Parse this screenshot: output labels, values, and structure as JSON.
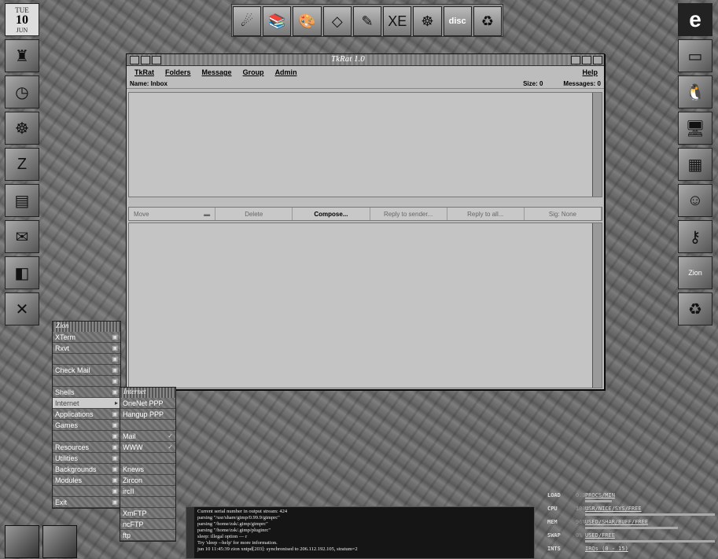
{
  "calendar": {
    "day": "TUE",
    "date": "10",
    "month": "JUN"
  },
  "top_launcher": {
    "items": [
      {
        "name": "comet-icon",
        "glyph": "☄"
      },
      {
        "name": "books-icon",
        "glyph": "📚"
      },
      {
        "name": "paint-palette-icon",
        "glyph": "🎨"
      },
      {
        "name": "draw-icon",
        "glyph": "◇"
      },
      {
        "name": "tools-icon",
        "glyph": "✎"
      },
      {
        "name": "xe-icon",
        "glyph": "XE"
      },
      {
        "name": "helm-icon",
        "glyph": "☸"
      },
      {
        "name": "disc-icon",
        "glyph": "disc"
      },
      {
        "name": "recycle-icon",
        "glyph": "♻"
      }
    ]
  },
  "left_dock": [
    "wizard-icon",
    "clock-icon",
    "helm-icon",
    "zion-z-icon",
    "document-icon",
    "mail-icon",
    "cube-icon",
    "x-icon"
  ],
  "right_dock": {
    "e_label": "e",
    "zion_label": "Zion"
  },
  "tkrat": {
    "title": "TkRat 1.0",
    "menu": {
      "tkrat": "TkRat",
      "folders": "Folders",
      "message": "Message",
      "group": "Group",
      "admin": "Admin",
      "help": "Help"
    },
    "info": {
      "name": "Name: Inbox",
      "size": "Size: 0",
      "messages": "Messages: 0"
    },
    "buttons": {
      "move": "Move",
      "delete": "Delete",
      "compose": "Compose...",
      "reply_sender": "Reply to sender...",
      "reply_all": "Reply to all...",
      "sig": "Sig: None"
    }
  },
  "root_menu": {
    "title": "Zion",
    "items": [
      "XTerm",
      "Rxvt",
      "",
      "Check Mail",
      "",
      "Shells",
      "Internet",
      "Applications",
      "Games",
      "",
      "Resources",
      "Utilities",
      "Backgrounds",
      "Modules",
      "",
      "Exit"
    ]
  },
  "internet_menu": {
    "title": "Internet",
    "items": [
      "OneNet PPP",
      "Hangup PPP",
      "",
      "Mail",
      "WWW",
      "",
      "Knews",
      "Zircon",
      "ircII",
      "",
      "XmFTP",
      "ncFTP",
      "ftp"
    ]
  },
  "terminal": {
    "lines": [
      "Current serial number in output stream: 424",
      "parsing \"/usr/share/gimp/0.99.9/gimprc\"",
      "parsing \"/home/zsk/.gimp/gimprc\"",
      "parsing \"/home/zsk/.gimp/pluginrc\"",
      "sleep: illegal option — r",
      "Try 'sleep --help' for more information.",
      "jun 10 11:45:39 zion xntpd[203]: synchronised to 206.112.192.105, stratum=2"
    ]
  },
  "monitor": {
    "load": {
      "label": "LOAD",
      "value": "0.3",
      "hdr": "PROCS/MIN"
    },
    "cpu": {
      "label": "CPU",
      "value": "100%",
      "hdr": "USR/NICE/SYS/FREE"
    },
    "mem": {
      "label": "MEM",
      "value": "96%",
      "hdr": "USED/SHAR/BUFF/FREE"
    },
    "swap": {
      "label": "SWAP",
      "value": "0%",
      "hdr": "USED/FREE"
    },
    "ints": {
      "label": "INTS",
      "value": "",
      "hdr": "IRQs (0 - 15)"
    }
  }
}
